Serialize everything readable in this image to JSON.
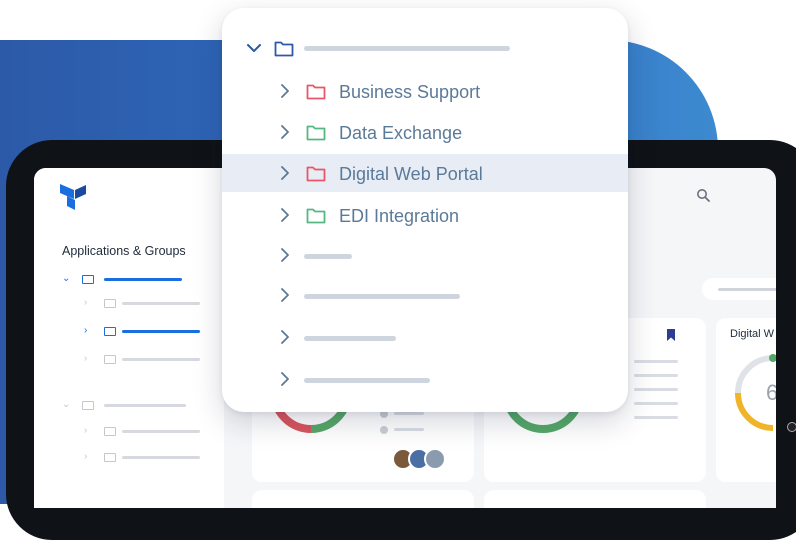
{
  "sidebar": {
    "title": "Applications & Groups",
    "groups": [
      {
        "expanded": true,
        "color": "#1a6fe0",
        "children": 3,
        "active_child": 1
      },
      {
        "expanded": true,
        "color": "#c3c8d0",
        "children": 2,
        "active_child": -1
      }
    ]
  },
  "tree_popup": {
    "items": [
      {
        "label": "Business Support",
        "folder_color": "#e8566a"
      },
      {
        "label": "Data Exchange",
        "folder_color": "#55b883"
      },
      {
        "label": "Digital Web Portal",
        "folder_color": "#e8566a",
        "selected": true
      },
      {
        "label": "EDI Integration",
        "folder_color": "#55b883"
      }
    ],
    "placeholder_rows": 4
  },
  "cards": {
    "digital_card_label": "Digital W",
    "gauge_digit": "6"
  },
  "colors": {
    "accent_blue": "#1a6fe0",
    "popup_text": "#5b7a99",
    "gauge_green": "#55a868",
    "gauge_red": "#d9555f",
    "gauge_yellow": "#f0b429",
    "bookmark": "#2c3e8f"
  }
}
